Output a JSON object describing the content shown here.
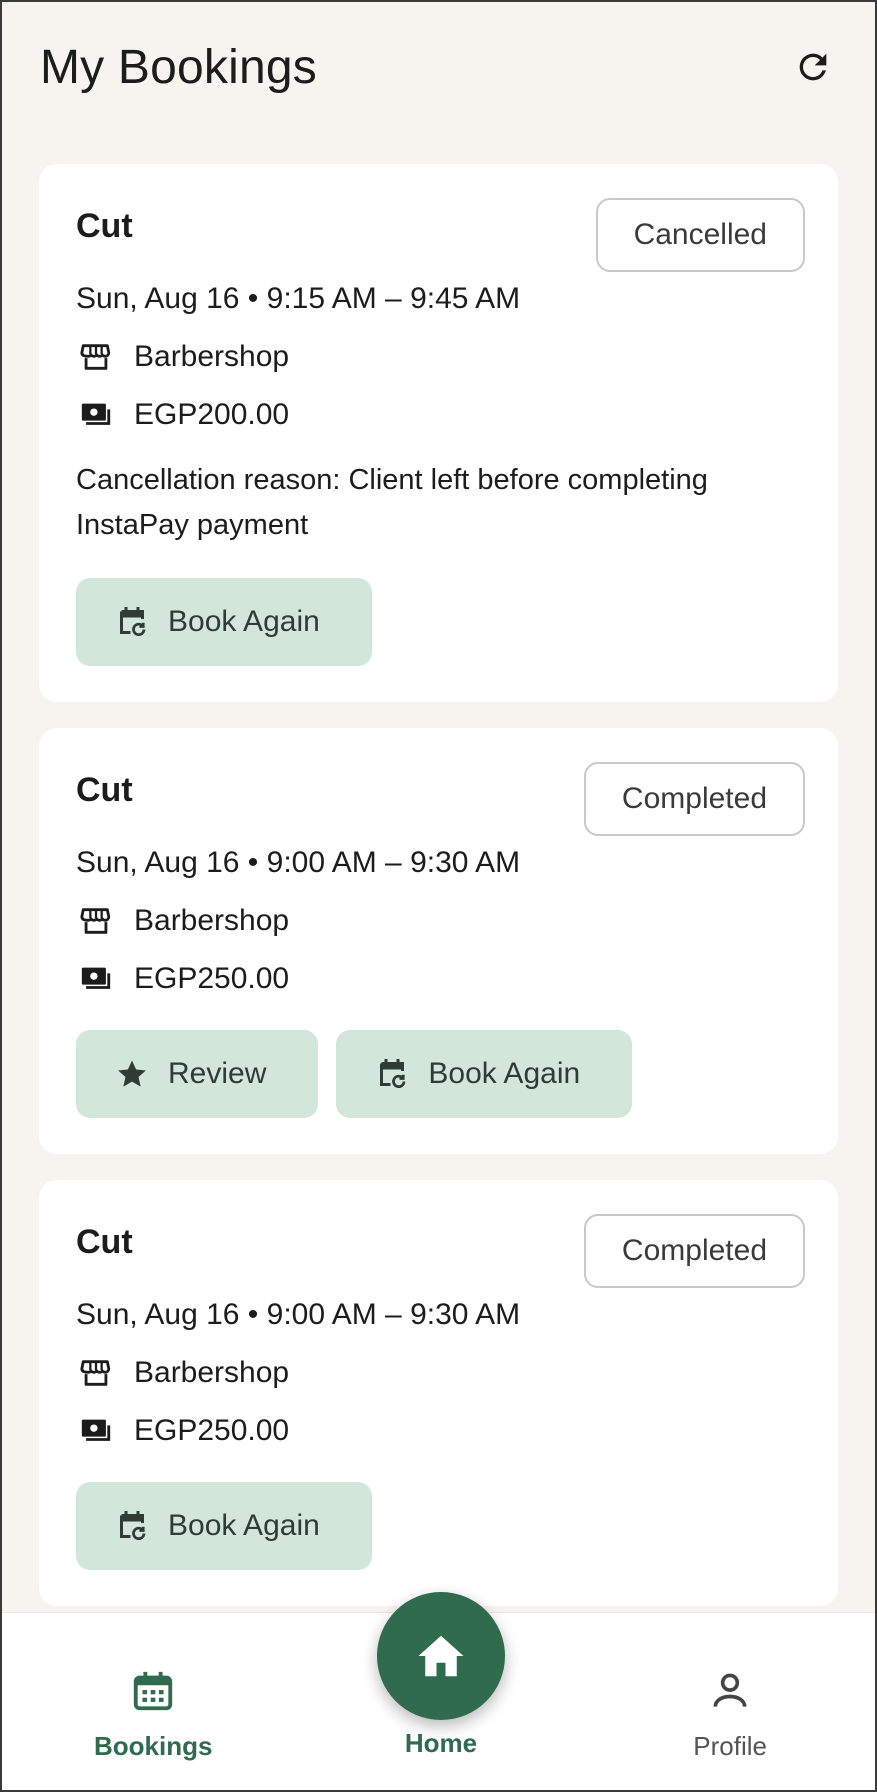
{
  "app": {
    "title": "My Bookings"
  },
  "colors": {
    "accent": "#2f6b4c",
    "button_bg": "#d2e7da",
    "background": "#f7f4f0"
  },
  "icons": {
    "refresh": "refresh-icon",
    "store": "storefront-icon",
    "money": "payments-icon",
    "calendar_repeat": "event-repeat-icon",
    "star": "star-icon",
    "home": "home-icon",
    "calendar": "calendar-icon",
    "profile": "person-icon"
  },
  "bookings": [
    {
      "title": "Cut",
      "status": "Cancelled",
      "when": "Sun, Aug 16 • 9:15 AM – 9:45 AM",
      "place": "Barbershop",
      "price": "EGP200.00",
      "reason": "Cancellation reason: Client left before completing InstaPay payment",
      "book_again": "Book Again"
    },
    {
      "title": "Cut",
      "status": "Completed",
      "when": "Sun, Aug 16 • 9:00 AM – 9:30 AM",
      "place": "Barbershop",
      "price": "EGP250.00",
      "review": "Review",
      "book_again": "Book Again"
    },
    {
      "title": "Cut",
      "status": "Completed",
      "when": "Sun, Aug 16 • 9:00 AM – 9:30 AM",
      "place": "Barbershop",
      "price": "EGP250.00",
      "book_again": "Book Again"
    }
  ],
  "nav": {
    "bookings": "Bookings",
    "home": "Home",
    "profile": "Profile"
  }
}
